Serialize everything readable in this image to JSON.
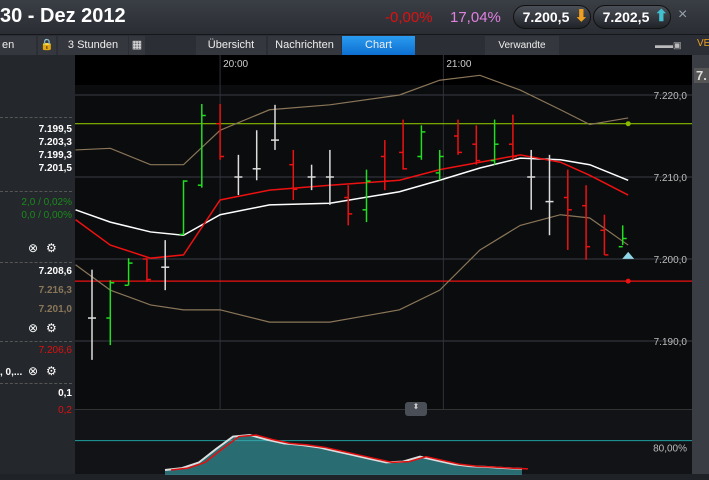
{
  "header": {
    "title": "30 - Dez 2012",
    "change_pct": "-0,00%",
    "volatility": "17,04%",
    "bid": "7.200,5",
    "ask": "7.202,5",
    "close": "×",
    "edge_label": "VE",
    "top_right_price": "7."
  },
  "toolbar": {
    "partial_label": "en",
    "interval": "3 Stunden",
    "tabs": [
      {
        "label": "Übersicht"
      },
      {
        "label": "Nachrichten"
      },
      {
        "label": "Chart",
        "active": true
      },
      {
        "label": "Verwandte"
      }
    ]
  },
  "left_panel": {
    "ohlc": [
      "7.199,5",
      "7.203,3",
      "7.199,3",
      "7.201,5"
    ],
    "change": [
      "2,0 / 0,02%",
      "0,0 / 0,00%"
    ],
    "bollinger": [
      "7.208,6",
      "7.216,3",
      "7.201,0"
    ],
    "ma": "7.206,6",
    "osc_params": ", 0,...",
    "osc_values": [
      "0,1",
      "0,2"
    ]
  },
  "colors": {
    "up": "#22dd22",
    "down": "#ee1111",
    "neutral": "#dddddd",
    "band": "#8a7658",
    "ma_fast": "#ee1111",
    "ma_slow": "#ffffff",
    "accent": "#1a86e0"
  },
  "chart_data": {
    "type": "ohlc",
    "x_labels": [
      {
        "label": "20:00",
        "index": 7
      },
      {
        "label": "21:00",
        "index": 19.2
      }
    ],
    "y_ticks": [
      "7.220,0",
      "7.210,0",
      "7.200,0",
      "7.190,0"
    ],
    "y_tick_values": [
      7220,
      7210,
      7200,
      7190
    ],
    "ylim": [
      7186,
      7228
    ],
    "bars": [
      [
        7198.7,
        7187.7,
        7192.8,
        7192.8
      ],
      [
        7197.4,
        7189.5,
        7192.8,
        7197.1
      ],
      [
        7200.1,
        7196.8,
        7196.8,
        7199.5
      ],
      [
        7200.1,
        7197.2,
        7200.0,
        7197.5
      ],
      [
        7202.3,
        7196.2,
        7199,
        7199
      ],
      [
        7209.6,
        7202.9,
        7203,
        7209.5
      ],
      [
        7218.9,
        7208.7,
        7209,
        7217.5
      ],
      [
        7218.9,
        7212.1,
        7216.5,
        7212.5
      ],
      [
        7212.7,
        7207.8,
        7210,
        7210
      ],
      [
        7215.7,
        7209.6,
        7211,
        7211
      ],
      [
        7218.8,
        7213.3,
        7214.5,
        7214.5
      ],
      [
        7213.3,
        7207.2,
        7211.5,
        7208.5
      ],
      [
        7211.5,
        7208.4,
        7210,
        7210
      ],
      [
        7213.3,
        7206.6,
        7210,
        7210
      ],
      [
        7209.0,
        7204.1,
        7207.5,
        7205.5
      ],
      [
        7210.9,
        7204.5,
        7206,
        7209.5
      ],
      [
        7214.5,
        7208.4,
        7212.5,
        7209.5
      ],
      [
        7217.0,
        7210.9,
        7213,
        7211
      ],
      [
        7216.3,
        7212.1,
        7212.5,
        7215.5
      ],
      [
        7213.3,
        7209.6,
        7210.5,
        7212.5
      ],
      [
        7217.0,
        7212.7,
        7215,
        7213
      ],
      [
        7216.3,
        7211.5,
        7214,
        7212
      ],
      [
        7217.0,
        7211.5,
        7212,
        7214
      ],
      [
        7217.6,
        7212.1,
        7214,
        7212.5
      ],
      [
        7213.3,
        7206.0,
        7210,
        7210
      ],
      [
        7212.7,
        7202.9,
        7207,
        7207
      ],
      [
        7210.9,
        7201.1,
        7207.5,
        7206
      ],
      [
        7209.0,
        7199.9,
        7206.5,
        7201.5
      ],
      [
        7205.4,
        7200.5,
        7203.5,
        7200.5
      ],
      [
        7204.1,
        7201.7,
        7201.5,
        7202.5
      ]
    ],
    "series": [
      {
        "name": "upper_band",
        "x": [
          -0.9,
          1,
          3.2,
          5,
          7,
          9.7,
          13,
          16.8,
          19,
          21.2,
          23.4,
          25.6,
          27.2,
          29.3
        ],
        "values": [
          7213.3,
          7213.5,
          7211.5,
          7211.5,
          7215.7,
          7218.2,
          7218.8,
          7220,
          7221.8,
          7222.4,
          7220.6,
          7218.2,
          7216.4,
          7217.2
        ]
      },
      {
        "name": "lower_band",
        "x": [
          -0.9,
          1,
          3.2,
          5,
          7,
          9.7,
          13,
          16.8,
          19,
          21.2,
          23.4,
          25.6,
          27.2,
          29.3
        ],
        "values": [
          7199.3,
          7196.2,
          7194.4,
          7193.8,
          7193.8,
          7192.3,
          7192.3,
          7193.8,
          7196.2,
          7201.1,
          7204.1,
          7205.4,
          7205,
          7201.7
        ]
      },
      {
        "name": "ma_slow",
        "x": [
          -0.9,
          1,
          3.2,
          5,
          7,
          9.7,
          13,
          16.8,
          19,
          21.2,
          23.4,
          25.6,
          27.2,
          29.3
        ],
        "values": [
          7206,
          7204.5,
          7203.3,
          7202.9,
          7205.4,
          7206.6,
          7206.8,
          7208.2,
          7209.6,
          7211.1,
          7212.3,
          7212.1,
          7211.5,
          7209.6
        ]
      },
      {
        "name": "ma_fast",
        "x": [
          -0.9,
          1,
          3.2,
          5,
          7,
          9.7,
          13,
          16.8,
          19,
          21.2,
          23.4,
          25.6,
          27.2,
          29.3
        ],
        "values": [
          7204.8,
          7201.7,
          7200.1,
          7200.5,
          7207.2,
          7208.4,
          7209,
          7209.6,
          7210.9,
          7211.8,
          7212.7,
          7211.8,
          7210.2,
          7207.8
        ]
      }
    ],
    "hlines": [
      {
        "name": "upper_level",
        "value": 7216.5,
        "color": "#88bb00"
      },
      {
        "name": "lower_level",
        "value": 7197.3,
        "color": "#ee1111"
      }
    ],
    "oscillator": {
      "level_label": "80,00%",
      "level": 80,
      "values": [
        0,
        5,
        20,
        55,
        88,
        92,
        80,
        70,
        66,
        60,
        50,
        40,
        30,
        20,
        22,
        35,
        25,
        15,
        10,
        8,
        5,
        3
      ]
    }
  }
}
